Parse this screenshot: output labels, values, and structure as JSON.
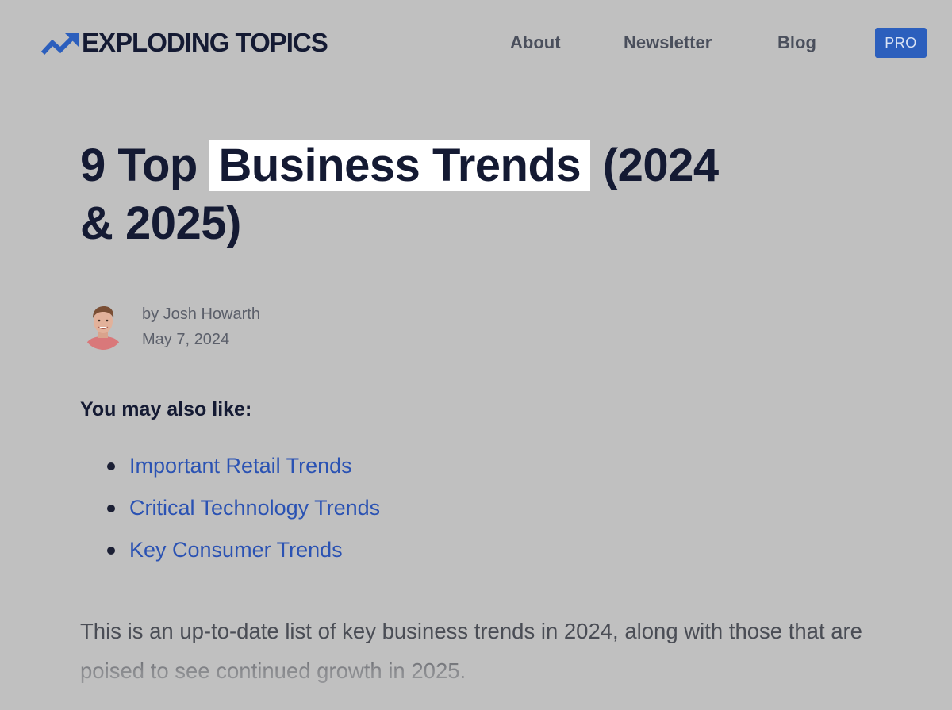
{
  "header": {
    "logo_text": "EXPLODING TOPICS",
    "logo_icon": "trending-up-arrow-icon",
    "nav": {
      "about": "About",
      "newsletter": "Newsletter",
      "blog": "Blog"
    },
    "pro_label": "PRO"
  },
  "article": {
    "title_start": "9 Top",
    "title_highlight": "Business Trends",
    "title_end": "(2024 & 2025)",
    "author": "by Josh Howarth",
    "date": "May 7, 2024",
    "also_like_heading": "You may also like:",
    "also_like_links": [
      "Important Retail Trends",
      "Critical Technology Trends",
      "Key Consumer Trends"
    ],
    "intro": "This is an up-to-date list of key business trends in 2024, along with those that are poised to see continued growth in 2025."
  },
  "colors": {
    "background": "#c0c0c0",
    "brand_blue": "#2c5fbd",
    "link_blue": "#2a52b3",
    "highlight": "#ffffff",
    "heading": "#141a33"
  }
}
